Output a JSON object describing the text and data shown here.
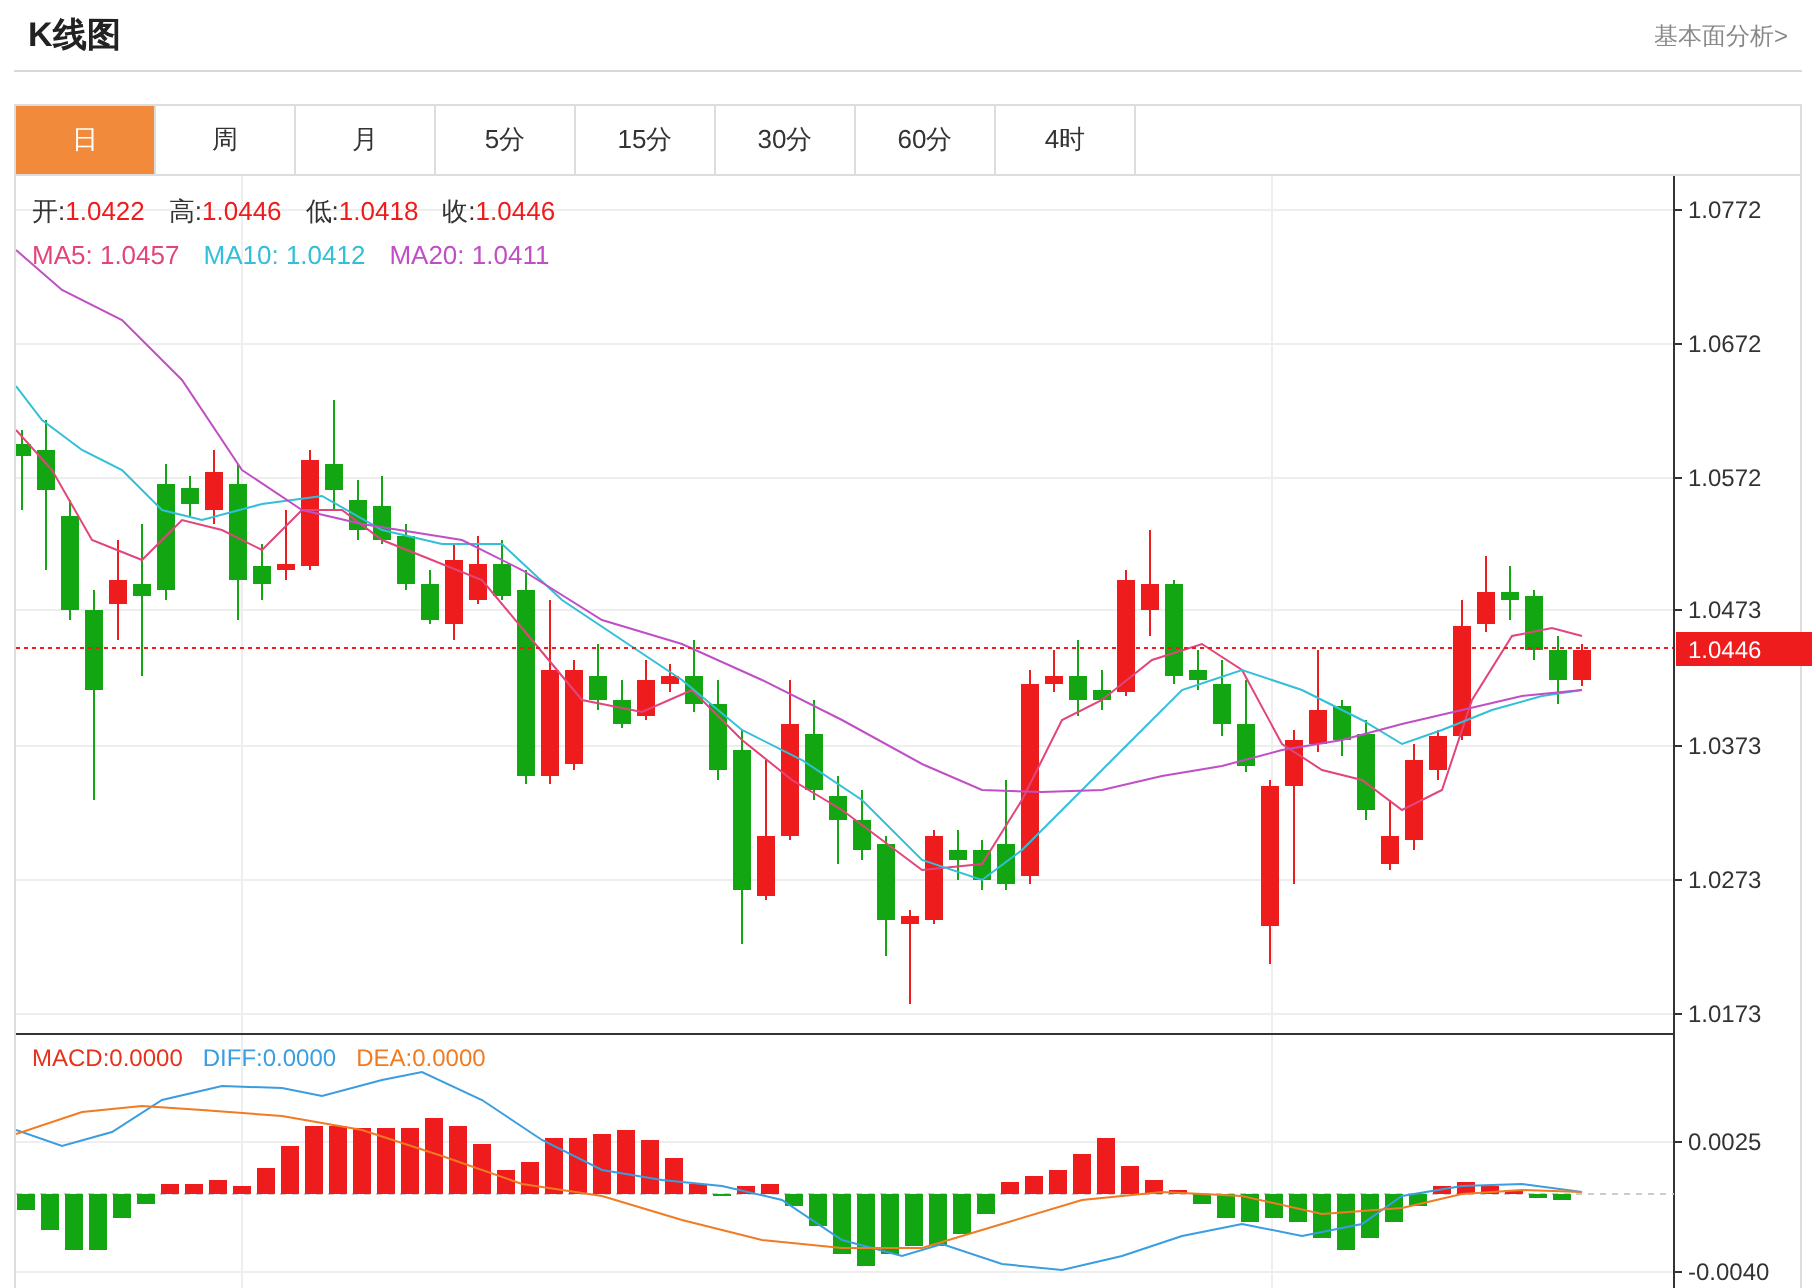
{
  "header": {
    "title": "K线图",
    "link": "基本面分析>"
  },
  "tabs": [
    {
      "label": "日",
      "selected": true
    },
    {
      "label": "周",
      "selected": false
    },
    {
      "label": "月",
      "selected": false
    },
    {
      "label": "5分",
      "selected": false
    },
    {
      "label": "15分",
      "selected": false
    },
    {
      "label": "30分",
      "selected": false
    },
    {
      "label": "60分",
      "selected": false
    },
    {
      "label": "4时",
      "selected": false
    }
  ],
  "ohlc": [
    {
      "label": "开:",
      "value": "1.0422"
    },
    {
      "label": "高:",
      "value": "1.0446"
    },
    {
      "label": "低:",
      "value": "1.0418"
    },
    {
      "label": "收:",
      "value": "1.0446"
    }
  ],
  "ma_legend": [
    {
      "label": "MA5:",
      "value": "1.0457",
      "color": "#e2457b"
    },
    {
      "label": "MA10:",
      "value": "1.0412",
      "color": "#32bfd8"
    },
    {
      "label": "MA20:",
      "value": "1.0411",
      "color": "#c04fc6"
    }
  ],
  "price_axis": {
    "ticks": [
      "1.0772",
      "1.0672",
      "1.0572",
      "1.0473",
      "1.0373",
      "1.0273",
      "1.0173"
    ],
    "current_price": "1.0446"
  },
  "macd_legend": [
    {
      "label": "MACD:",
      "value": "0.0000",
      "color": "#e8311a"
    },
    {
      "label": "DIFF:",
      "value": "0.0000",
      "color": "#3a9de0"
    },
    {
      "label": "DEA:",
      "value": "0.0000",
      "color": "#f07b22"
    }
  ],
  "macd_axis": {
    "ticks": [
      "0.0025",
      "-0.0040"
    ]
  }
}
